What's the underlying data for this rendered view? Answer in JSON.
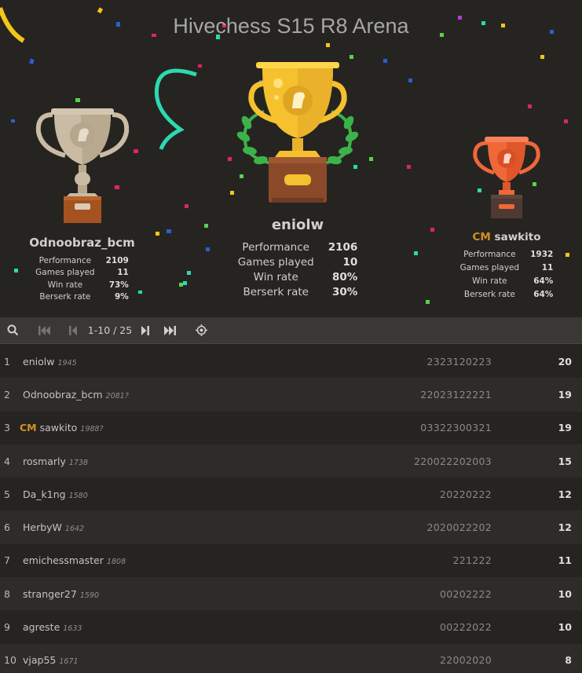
{
  "header": {
    "title": "Hivechess S15 R8 Arena"
  },
  "podium": {
    "first": {
      "name": "eniolw",
      "stats": [
        {
          "label": "Performance",
          "value": "2106"
        },
        {
          "label": "Games played",
          "value": "10"
        },
        {
          "label": "Win rate",
          "value": "80%"
        },
        {
          "label": "Berserk rate",
          "value": "30%"
        }
      ]
    },
    "second": {
      "name": "Odnoobraz_bcm",
      "stats": [
        {
          "label": "Performance",
          "value": "2109"
        },
        {
          "label": "Games played",
          "value": "11"
        },
        {
          "label": "Win rate",
          "value": "73%"
        },
        {
          "label": "Berserk rate",
          "value": "9%"
        }
      ]
    },
    "third": {
      "title": "CM",
      "name": "sawkito",
      "stats": [
        {
          "label": "Performance",
          "value": "1932"
        },
        {
          "label": "Games played",
          "value": "11"
        },
        {
          "label": "Win rate",
          "value": "64%"
        },
        {
          "label": "Berserk rate",
          "value": "64%"
        }
      ]
    }
  },
  "pager": {
    "search_icon": "search-icon",
    "first_icon": "first-page-icon",
    "prev_icon": "prev-page-icon",
    "range": "1-10 / 25",
    "next_icon": "next-page-icon",
    "last_icon": "last-page-icon",
    "me_icon": "crosshair-icon"
  },
  "standings": [
    {
      "rank": "1",
      "title": "",
      "name": "eniolw",
      "rating": "1945",
      "sheet": "2323120223",
      "score": "20"
    },
    {
      "rank": "2",
      "title": "",
      "name": "Odnoobraz_bcm",
      "rating": "2081?",
      "sheet": "22023122221",
      "score": "19"
    },
    {
      "rank": "3",
      "title": "CM",
      "name": "sawkito",
      "rating": "1988?",
      "sheet": "03322300321",
      "score": "19"
    },
    {
      "rank": "4",
      "title": "",
      "name": "rosmarly",
      "rating": "1738",
      "sheet": "220022202003",
      "score": "15"
    },
    {
      "rank": "5",
      "title": "",
      "name": "Da_k1ng",
      "rating": "1580",
      "sheet": "20220222",
      "score": "12"
    },
    {
      "rank": "6",
      "title": "",
      "name": "HerbyW",
      "rating": "1642",
      "sheet": "2020022202",
      "score": "12"
    },
    {
      "rank": "7",
      "title": "",
      "name": "emichessmaster",
      "rating": "1808",
      "sheet": "221222",
      "score": "11"
    },
    {
      "rank": "8",
      "title": "",
      "name": "stranger27",
      "rating": "1590",
      "sheet": "00202222",
      "score": "10"
    },
    {
      "rank": "9",
      "title": "",
      "name": "agreste",
      "rating": "1633",
      "sheet": "00222022",
      "score": "10"
    },
    {
      "rank": "10",
      "title": "",
      "name": "vjap55",
      "rating": "1671",
      "sheet": "22002020",
      "score": "8"
    }
  ],
  "colors": {
    "background": "#262421",
    "title_accent": "#d59120",
    "gold": "#f5c12e",
    "silver": "#c9bba4",
    "bronze": "#f0673a"
  }
}
